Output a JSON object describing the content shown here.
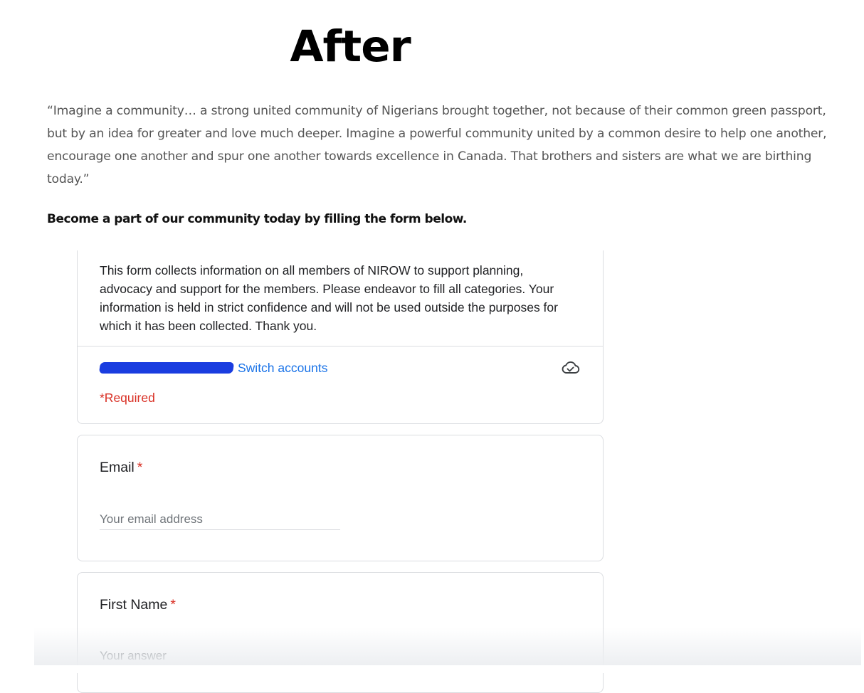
{
  "heading": "After",
  "quote": "“Imagine a community… a strong united community of Nigerians brought together, not because of their common green passport, but by an idea for greater and love much deeper. Imagine a powerful community united by a common desire to help one another, encourage one another and spur one another towards excellence in Canada. That brothers and sisters are what we are birthing today.”",
  "cta": "Become a part of our community today by filling the form below.",
  "form": {
    "description": "This form collects information on all members of NIROW to support planning, advocacy and support for the members. Please endeavor to fill all categories. Your information is held in strict confidence and will not be used outside the purposes for which it has been collected. Thank you.",
    "switch_accounts": "Switch accounts",
    "required_note": "*Required",
    "questions": [
      {
        "label": "Email",
        "required_mark": "*",
        "placeholder": "Your email address",
        "value": ""
      },
      {
        "label": "First Name",
        "required_mark": "*",
        "placeholder": "Your answer",
        "value": ""
      }
    ],
    "icons": {
      "cloud": "cloud-saved-icon"
    },
    "colors": {
      "link": "#1a73e8",
      "required": "#d93025",
      "redaction": "#1a3de0"
    }
  }
}
